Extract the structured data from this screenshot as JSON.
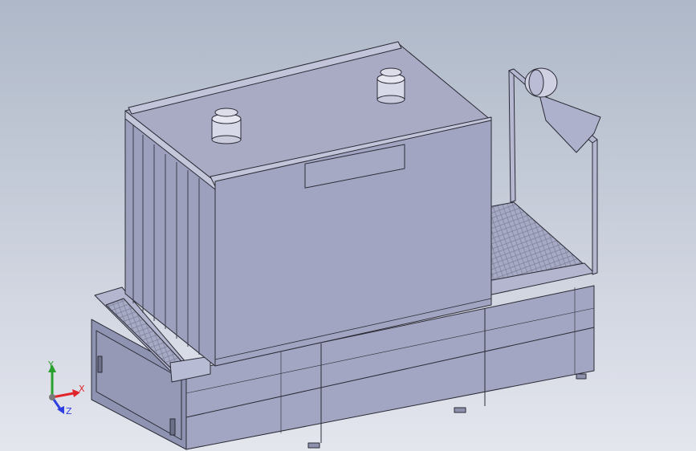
{
  "viewport": {
    "background_top": "#aeb8c8",
    "background_bottom": "#e4e6ee",
    "model_color": "#a3a6c2",
    "edge_color": "#2b2b36"
  },
  "triad": {
    "x_label": "X",
    "y_label": "Y",
    "z_label": "Z",
    "x_color": "#e0242a",
    "y_color": "#2aa02e",
    "z_color": "#2f3ee0"
  }
}
